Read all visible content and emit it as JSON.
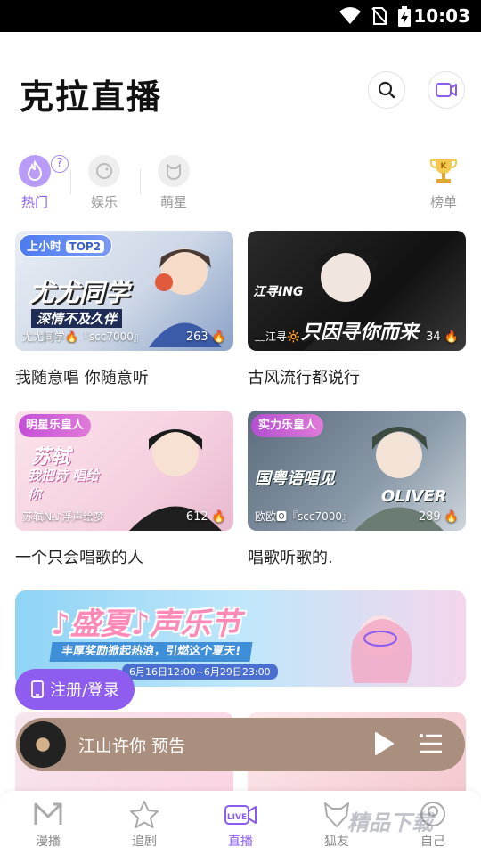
{
  "status_bar": {
    "time": "10:03"
  },
  "header": {
    "title": "克拉直播"
  },
  "categories": [
    {
      "label": "热门",
      "active": true
    },
    {
      "label": "娱乐",
      "active": false
    },
    {
      "label": "萌星",
      "active": false
    },
    {
      "label": "榜单",
      "active": false
    }
  ],
  "help_badge": "?",
  "cards": [
    {
      "title": "我随意唱 你随意听",
      "owner": "尤尤同学🔥『scc7000』",
      "viewers": "263",
      "tag": "上小时",
      "tag2": "TOP2",
      "art_text": "尤尤同学",
      "art_text2": "深情不及久伴"
    },
    {
      "title": "古风流行都说行",
      "owner": "﹏江寻🔆",
      "viewers": "34",
      "art_text": "只因寻你而来",
      "art_text2": "江寻ING"
    },
    {
      "title": "一个只会唱歌的人",
      "owner": "苏轼№♪浮声绘梦",
      "viewers": "612",
      "tag": "明星乐皇人",
      "art_text": "苏轼",
      "art_text2": "我把诗 唱给你"
    },
    {
      "title": "唱歌听歌的.",
      "owner": "欧欧🅾『scc7000』",
      "viewers": "289",
      "tag": "实力乐皇人",
      "art_text": "国粤语唱见",
      "art_text2": "OLIVER"
    }
  ],
  "banner": {
    "title": "♪盛夏♪声乐节",
    "subtitle": "丰厚奖励掀起热浪，引燃这个夏天!",
    "date": "6月16日12:00~6月29日23:00"
  },
  "login_button": "注册/登录",
  "player": {
    "title": "江山许你 预告"
  },
  "tabs": [
    {
      "label": "漫播",
      "active": false
    },
    {
      "label": "追剧",
      "active": false
    },
    {
      "label": "直播",
      "active": true
    },
    {
      "label": "狐友",
      "active": false
    },
    {
      "label": "自己",
      "active": false
    }
  ],
  "watermark": "精品下载",
  "colors": {
    "accent": "#8a5cf0",
    "player_bg": "#aa8f7e",
    "status_bar": "#000000"
  }
}
